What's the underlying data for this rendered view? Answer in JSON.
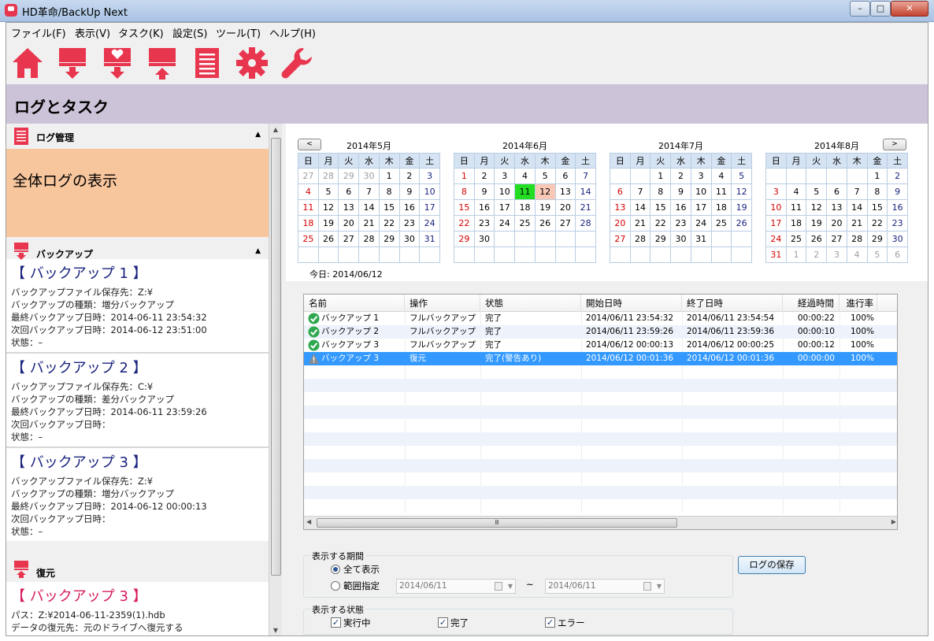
{
  "window": {
    "title": "HD革命/BackUp Next",
    "min": "–",
    "max": "□",
    "close": "✕"
  },
  "menu": [
    "ファイル(F)",
    "表示(V)",
    "タスク(K)",
    "設定(S)",
    "ツール(T)",
    "ヘルプ(H)"
  ],
  "toolbar_icons": [
    "home-icon",
    "backup-icon",
    "favorite-backup-icon",
    "restore-icon",
    "log-icon",
    "settings-icon",
    "tools-icon"
  ],
  "page_title": "ログとタスク",
  "colors": {
    "accent": "#e8364f",
    "header_band": "#cdc3d8",
    "log_box": "#f8c69d",
    "selected_row": "#3399ff",
    "today": "#22dd22"
  },
  "left": {
    "log_section": {
      "title": "ログ管理",
      "item": "全体ログの表示"
    },
    "backup_section": {
      "title": "バックアップ",
      "items": [
        {
          "name": "【 バックアップ 1 】",
          "lines": [
            "バックアップファイル保存先：Z:¥",
            "バックアップの種類：増分バックアップ",
            "最終バックアップ日時：2014-06-11 23:54:32",
            "次回バックアップ日時：2014-06-12 23:51:00",
            "状態：–"
          ]
        },
        {
          "name": "【 バックアップ 2 】",
          "lines": [
            "バックアップファイル保存先：C:¥",
            "バックアップの種類：差分バックアップ",
            "最終バックアップ日時：2014-06-11 23:59:26",
            "次回バックアップ日時：",
            "状態：–"
          ]
        },
        {
          "name": "【 バックアップ 3 】",
          "lines": [
            "バックアップファイル保存先：Z:¥",
            "バックアップの種類：増分バックアップ",
            "最終バックアップ日時：2014-06-12 00:00:13",
            "次回バックアップ日時：",
            "状態：–"
          ]
        }
      ]
    },
    "restore_section": {
      "title": "復元",
      "item": {
        "name": "【 バックアップ 3 】",
        "lines": [
          "パス：Z:¥2014-06-11-2359(1).hdb",
          "データの復元先：元のドライブへ復元する"
        ]
      }
    }
  },
  "calendar": {
    "weekdays": [
      "日",
      "月",
      "火",
      "水",
      "木",
      "金",
      "土"
    ],
    "prev": "<",
    "next": ">",
    "today_label": "今日: 2014/06/12",
    "months": [
      {
        "title": "2014年5月",
        "weeks": [
          [
            "27",
            "28",
            "29",
            "30",
            "1",
            "2",
            "3"
          ],
          [
            "4",
            "5",
            "6",
            "7",
            "8",
            "9",
            "10"
          ],
          [
            "11",
            "12",
            "13",
            "14",
            "15",
            "16",
            "17"
          ],
          [
            "18",
            "19",
            "20",
            "21",
            "22",
            "23",
            "24"
          ],
          [
            "25",
            "26",
            "27",
            "28",
            "29",
            "30",
            "31"
          ],
          [
            "",
            "",
            "",
            "",
            "",
            "",
            ""
          ]
        ]
      },
      {
        "title": "2014年6月",
        "weeks": [
          [
            "1",
            "2",
            "3",
            "4",
            "5",
            "6",
            "7"
          ],
          [
            "8",
            "9",
            "10",
            "11",
            "12",
            "13",
            "14"
          ],
          [
            "15",
            "16",
            "17",
            "18",
            "19",
            "20",
            "21"
          ],
          [
            "22",
            "23",
            "24",
            "25",
            "26",
            "27",
            "28"
          ],
          [
            "29",
            "30",
            "",
            "",
            "",
            "",
            ""
          ],
          [
            "",
            "",
            "",
            "",
            "",
            "",
            ""
          ]
        ]
      },
      {
        "title": "2014年7月",
        "weeks": [
          [
            "",
            "",
            "1",
            "2",
            "3",
            "4",
            "5"
          ],
          [
            "6",
            "7",
            "8",
            "9",
            "10",
            "11",
            "12"
          ],
          [
            "13",
            "14",
            "15",
            "16",
            "17",
            "18",
            "19"
          ],
          [
            "20",
            "21",
            "22",
            "23",
            "24",
            "25",
            "26"
          ],
          [
            "27",
            "28",
            "29",
            "30",
            "31",
            "",
            ""
          ],
          [
            "",
            "",
            "",
            "",
            "",
            "",
            ""
          ]
        ]
      },
      {
        "title": "2014年8月",
        "weeks": [
          [
            "",
            "",
            "",
            "",
            "",
            "1",
            "2"
          ],
          [
            "3",
            "4",
            "5",
            "6",
            "7",
            "8",
            "9"
          ],
          [
            "10",
            "11",
            "12",
            "13",
            "14",
            "15",
            "16"
          ],
          [
            "17",
            "18",
            "19",
            "20",
            "21",
            "22",
            "23"
          ],
          [
            "24",
            "25",
            "26",
            "27",
            "28",
            "29",
            "30"
          ],
          [
            "31",
            "1",
            "2",
            "3",
            "4",
            "5",
            "6"
          ]
        ]
      }
    ]
  },
  "log_table": {
    "columns": [
      "名前",
      "操作",
      "状態",
      "開始日時",
      "終了日時",
      "経過時間",
      "進行率"
    ],
    "rows": [
      {
        "status_icon": "ok-check-icon",
        "name": "バックアップ 1",
        "op": "フルバックアップ",
        "state": "完了",
        "start": "2014/06/11 23:54:32",
        "end": "2014/06/11 23:54:54",
        "elapsed": "00:00:22",
        "progress": "100%"
      },
      {
        "status_icon": "ok-check-icon",
        "name": "バックアップ 2",
        "op": "フルバックアップ",
        "state": "完了",
        "start": "2014/06/11 23:59:26",
        "end": "2014/06/11 23:59:36",
        "elapsed": "00:00:10",
        "progress": "100%"
      },
      {
        "status_icon": "ok-check-icon",
        "name": "バックアップ 3",
        "op": "フルバックアップ",
        "state": "完了",
        "start": "2014/06/12 00:00:13",
        "end": "2014/06/12 00:00:25",
        "elapsed": "00:00:12",
        "progress": "100%"
      },
      {
        "status_icon": "warning-icon",
        "name": "バックアップ 3",
        "op": "復元",
        "state": "完了(警告あり)",
        "start": "2014/06/12 00:01:36",
        "end": "2014/06/12 00:01:36",
        "elapsed": "00:00:00",
        "progress": "100%"
      }
    ]
  },
  "filters": {
    "period": {
      "title": "表示する期間",
      "all": "全て表示",
      "range": "範囲指定",
      "from": "2014/06/11",
      "sep": "~",
      "to": "2014/06/11"
    },
    "status": {
      "title": "表示する状態",
      "running": "実行中",
      "done": "完了",
      "error": "エラー"
    }
  },
  "save_button": "ログの保存"
}
